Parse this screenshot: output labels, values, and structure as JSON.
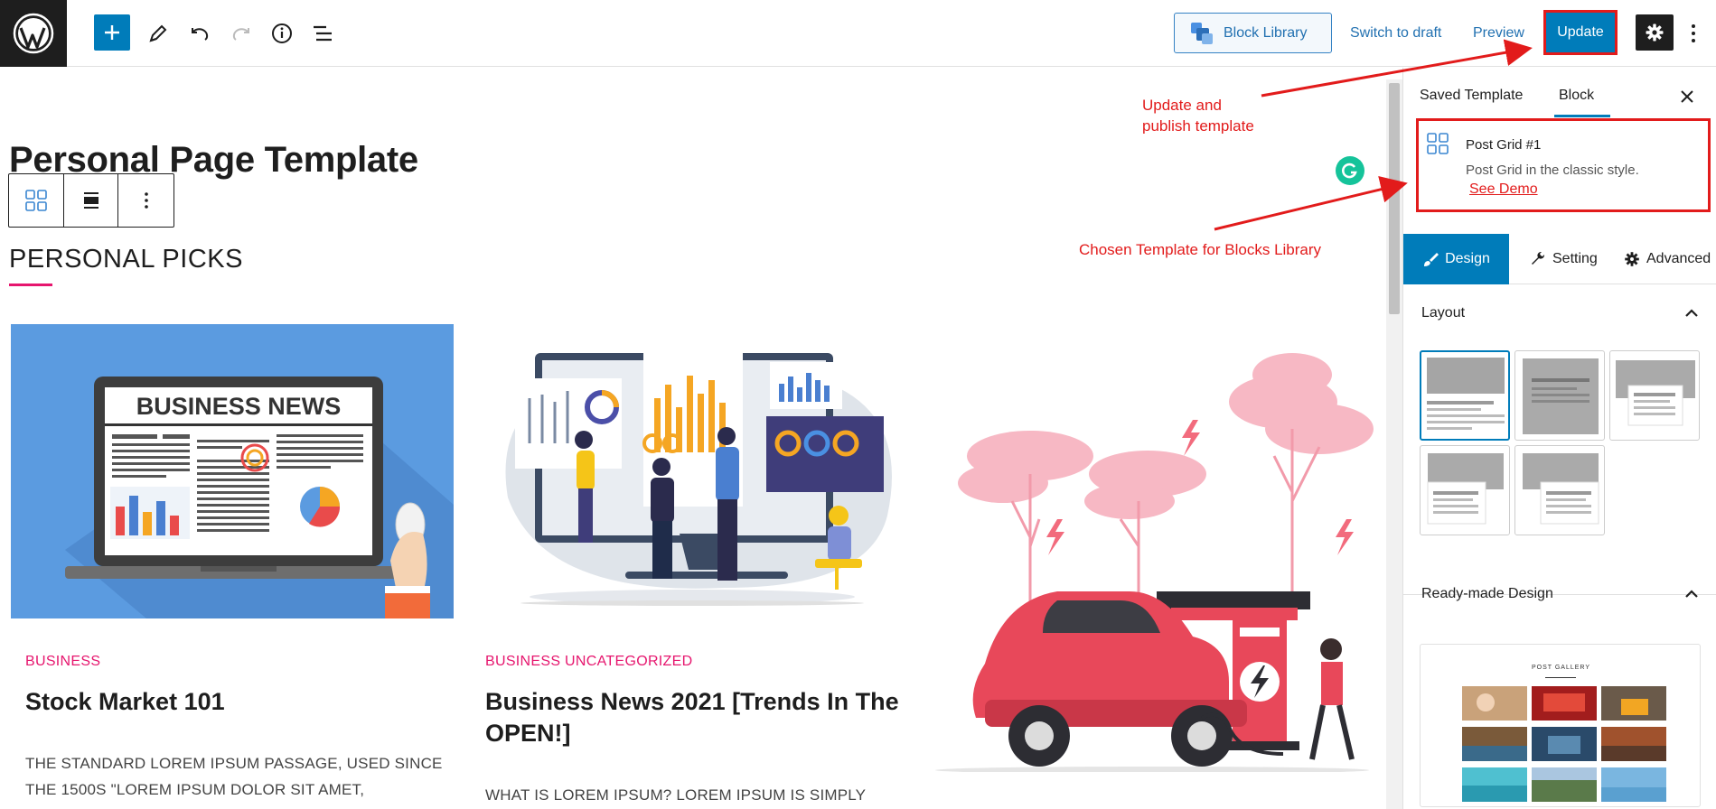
{
  "toolbar": {
    "block_library_label": "Block Library",
    "switch_to_draft_label": "Switch to draft",
    "preview_label": "Preview",
    "update_label": "Update"
  },
  "editor": {
    "page_title": "Personal Page Template",
    "section_heading": "PERSONAL PICKS",
    "posts": [
      {
        "category": "BUSINESS",
        "title": "Stock Market 101",
        "excerpt_line1": "THE STANDARD LOREM IPSUM PASSAGE, USED SINCE",
        "excerpt_line2": "THE 1500S \"LOREM IPSUM DOLOR SIT AMET,"
      },
      {
        "category": "BUSINESS UNCATEGORIZED",
        "title_line1": "Business News 2021 [Trends In The",
        "title_line2": "OPEN!]",
        "excerpt_line1": "WHAT IS LOREM IPSUM? LOREM IPSUM IS SIMPLY"
      }
    ],
    "newspaper_headline": "BUSINESS NEWS"
  },
  "sidebar": {
    "tabs": [
      "Saved Template",
      "Block"
    ],
    "block_card": {
      "title": "Post Grid #1",
      "description": "Post Grid in the classic style.",
      "link": "See Demo"
    },
    "setting_tabs": [
      "Design",
      "Setting",
      "Advanced"
    ],
    "layout_heading": "Layout",
    "readymade_heading": "Ready-made Design",
    "gallery_label": "POST GALLERY"
  },
  "annotations": {
    "update_line1": "Update and",
    "update_line2": "publish template",
    "chosen": "Chosen Template for Blocks Library"
  },
  "colors": {
    "accent": "#007cba",
    "pink": "#e6166e",
    "annotation_red": "#e21b1b",
    "dark": "#1e1e1e"
  }
}
